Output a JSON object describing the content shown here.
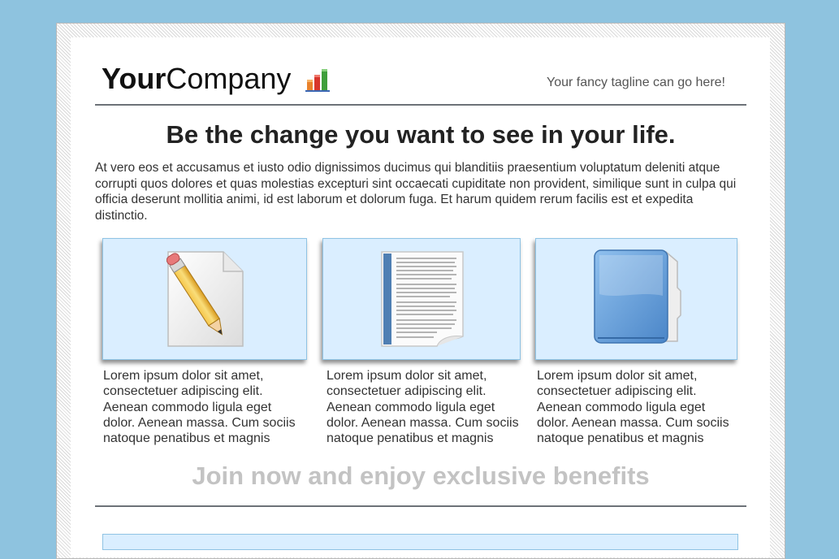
{
  "header": {
    "logo_bold": "Your",
    "logo_regular": "Company",
    "tagline": "Your fancy tagline can go here!"
  },
  "hero": {
    "headline": "Be the change you want to see in your life.",
    "intro": "At vero eos et accusamus et iusto odio dignissimos ducimus qui blanditiis praesentium voluptatum deleniti atque corrupti quos dolores et quas molestias excepturi sint occaecati cupiditate non provident, similique sunt in culpa qui officia deserunt mollitia animi, id est laborum et dolorum fuga. Et harum quidem rerum facilis est et expedita distinctio."
  },
  "features": [
    {
      "icon": "pencil-document-icon",
      "text": "Lorem ipsum dolor sit amet, consectetuer adipiscing elit. Aenean commodo ligula eget dolor. Aenean massa. Cum sociis natoque penatibus et magnis"
    },
    {
      "icon": "text-document-icon",
      "text": "Lorem ipsum dolor sit amet, consectetuer adipiscing elit. Aenean commodo ligula eget dolor. Aenean massa. Cum sociis natoque penatibus et magnis"
    },
    {
      "icon": "blue-folder-icon",
      "text": "Lorem ipsum dolor sit amet, consectetuer adipiscing elit. Aenean commodo ligula eget dolor. Aenean massa. Cum sociis natoque penatibus et magnis"
    }
  ],
  "cta": {
    "text": "Join now and enjoy exclusive benefits"
  },
  "colors": {
    "background": "#8ec3df",
    "card_fill": "#daeeff",
    "card_border": "#8fc3e4",
    "divider": "#6d7278",
    "cta_text": "#c3c3c3"
  }
}
